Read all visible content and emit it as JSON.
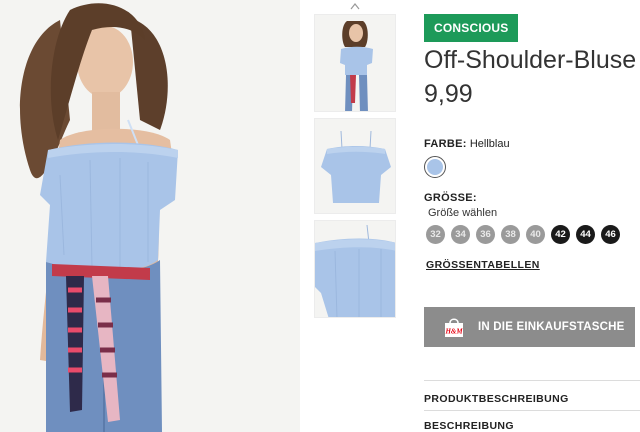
{
  "product": {
    "badge": "CONSCIOUS",
    "title": "Off-Shoulder-Bluse",
    "price": "9,99",
    "color": {
      "label": "FARBE:",
      "value": "Hellblau",
      "swatch_hex": "#a9c4e8"
    },
    "size": {
      "label": "GRÖSSE:",
      "hint": "Größe wählen",
      "options": [
        {
          "label": "32",
          "available": false
        },
        {
          "label": "34",
          "available": false
        },
        {
          "label": "36",
          "available": false
        },
        {
          "label": "38",
          "available": false
        },
        {
          "label": "40",
          "available": false
        },
        {
          "label": "42",
          "available": true
        },
        {
          "label": "44",
          "available": true
        },
        {
          "label": "46",
          "available": true
        }
      ],
      "chart_link": "GRÖSSENTABELLEN"
    },
    "add_to_bag": {
      "label": "IN DIE EINKAUFSTASCHE",
      "icon": "shopping-bag-icon",
      "icon_text": "H&M"
    },
    "sections": [
      {
        "label": "PRODUKTBESCHREIBUNG"
      },
      {
        "label": "BESCHREIBUNG"
      }
    ]
  },
  "gallery": {
    "thumbnails": [
      "model-front",
      "product-flat",
      "product-detail"
    ]
  },
  "colors": {
    "badge_green": "#1d9a59",
    "button_grey": "#8c8c8c",
    "size_unavailable": "#9a9a9a",
    "size_available": "#1a1a1a"
  }
}
